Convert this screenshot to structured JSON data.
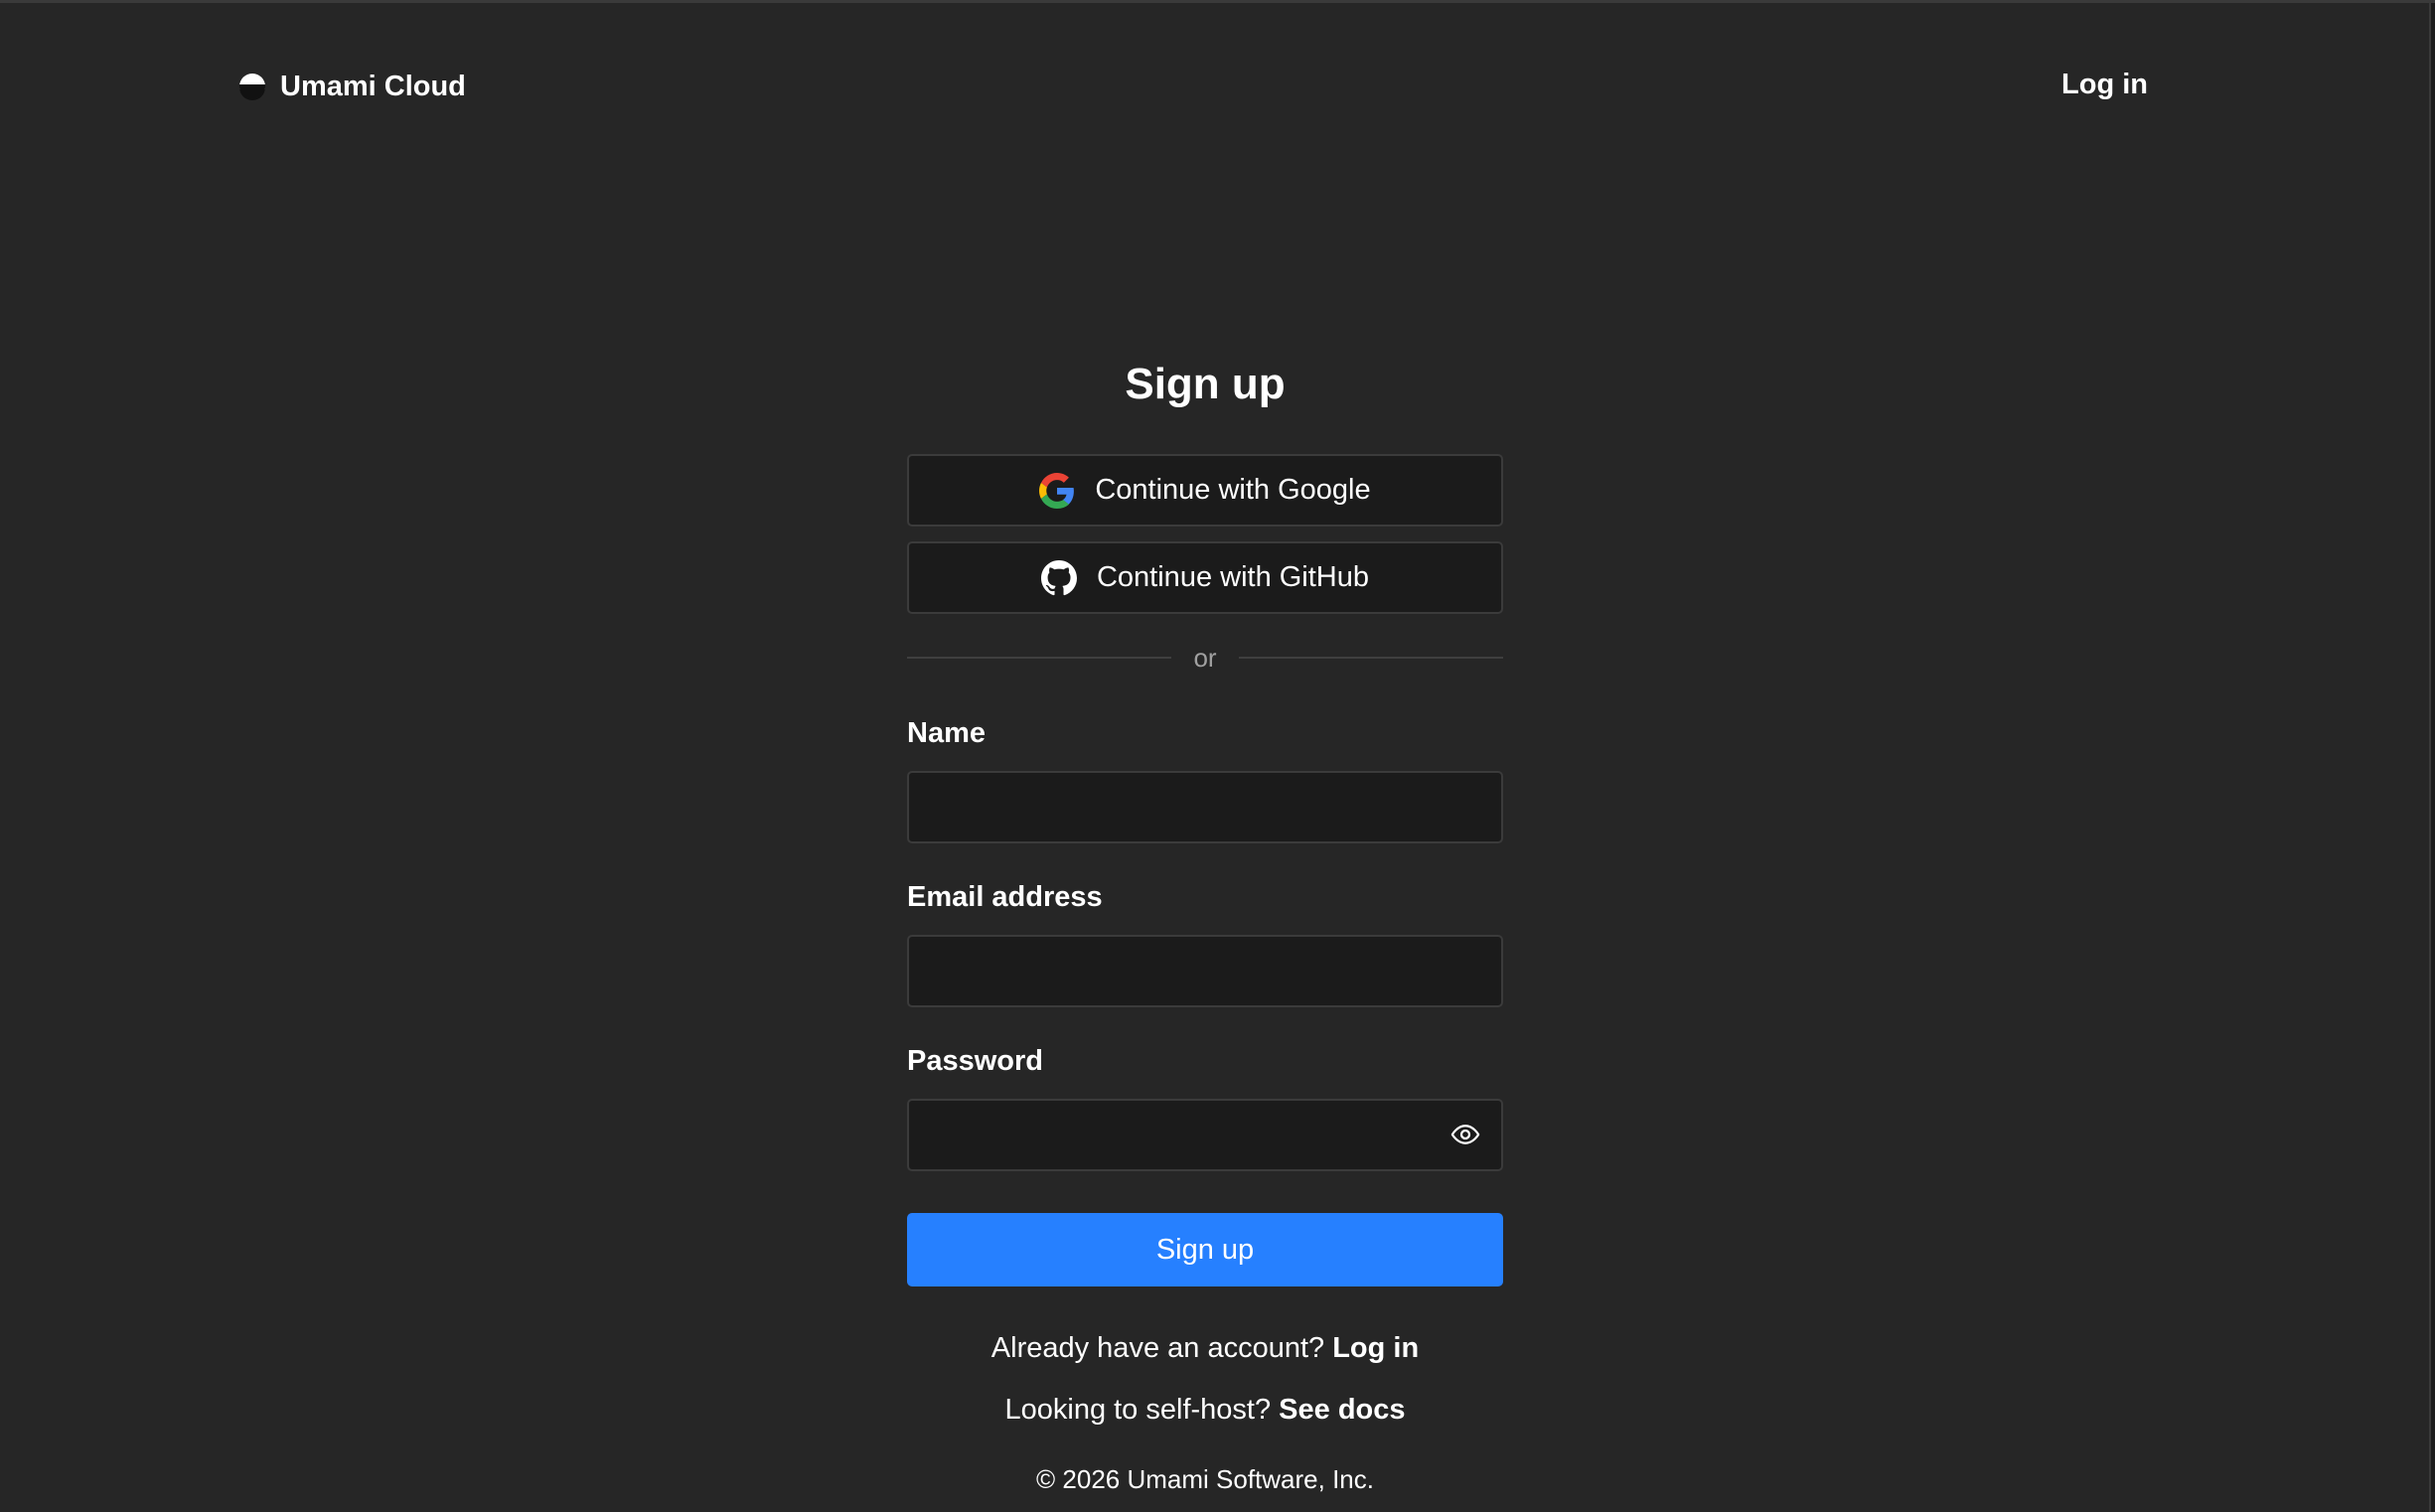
{
  "header": {
    "brand_name": "Umami Cloud",
    "login_label": "Log in"
  },
  "form": {
    "title": "Sign up",
    "google_label": "Continue with Google",
    "github_label": "Continue with GitHub",
    "divider_text": "or",
    "name_label": "Name",
    "name_value": "",
    "email_label": "Email address",
    "email_value": "",
    "password_label": "Password",
    "password_value": "",
    "submit_label": "Sign up"
  },
  "footer": {
    "account_prompt": "Already have an account?",
    "account_link": "Log in",
    "selfhost_prompt": "Looking to self-host?",
    "selfhost_link": "See docs",
    "copyright": "© 2026 Umami Software, Inc."
  },
  "icons": {
    "brand": "umami-logo-icon",
    "google": "google-icon",
    "github": "github-icon",
    "password_toggle": "eye-icon"
  },
  "colors": {
    "background": "#262626",
    "input_background": "#1b1b1b",
    "border": "#3b3b3b",
    "primary": "#2680ff",
    "text": "#ffffff",
    "muted": "#a0a0a0"
  }
}
